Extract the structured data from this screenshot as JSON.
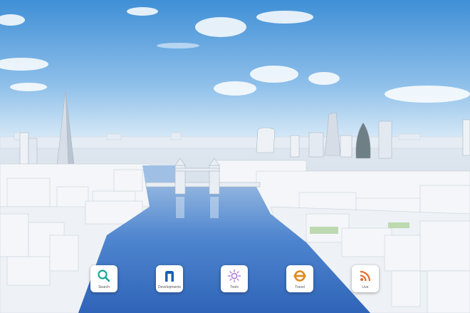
{
  "dock": {
    "items": [
      {
        "label": "Search",
        "icon": "search-icon",
        "color": "#1aa59a"
      },
      {
        "label": "Developments",
        "icon": "developments-icon",
        "color": "#1a5fb4"
      },
      {
        "label": "Tools",
        "icon": "sun-icon",
        "color": "#b07ad6"
      },
      {
        "label": "Travel",
        "icon": "underground-roundel-icon",
        "color": "#e08a1e"
      },
      {
        "label": "Live",
        "icon": "rss-feed-icon",
        "color": "#e26a2c"
      }
    ]
  },
  "colors": {
    "sky_top": "#3f8fd6",
    "sky_bottom": "#d8eaf7",
    "river": "#3c73c4",
    "buildings": "#f2f4f7"
  }
}
